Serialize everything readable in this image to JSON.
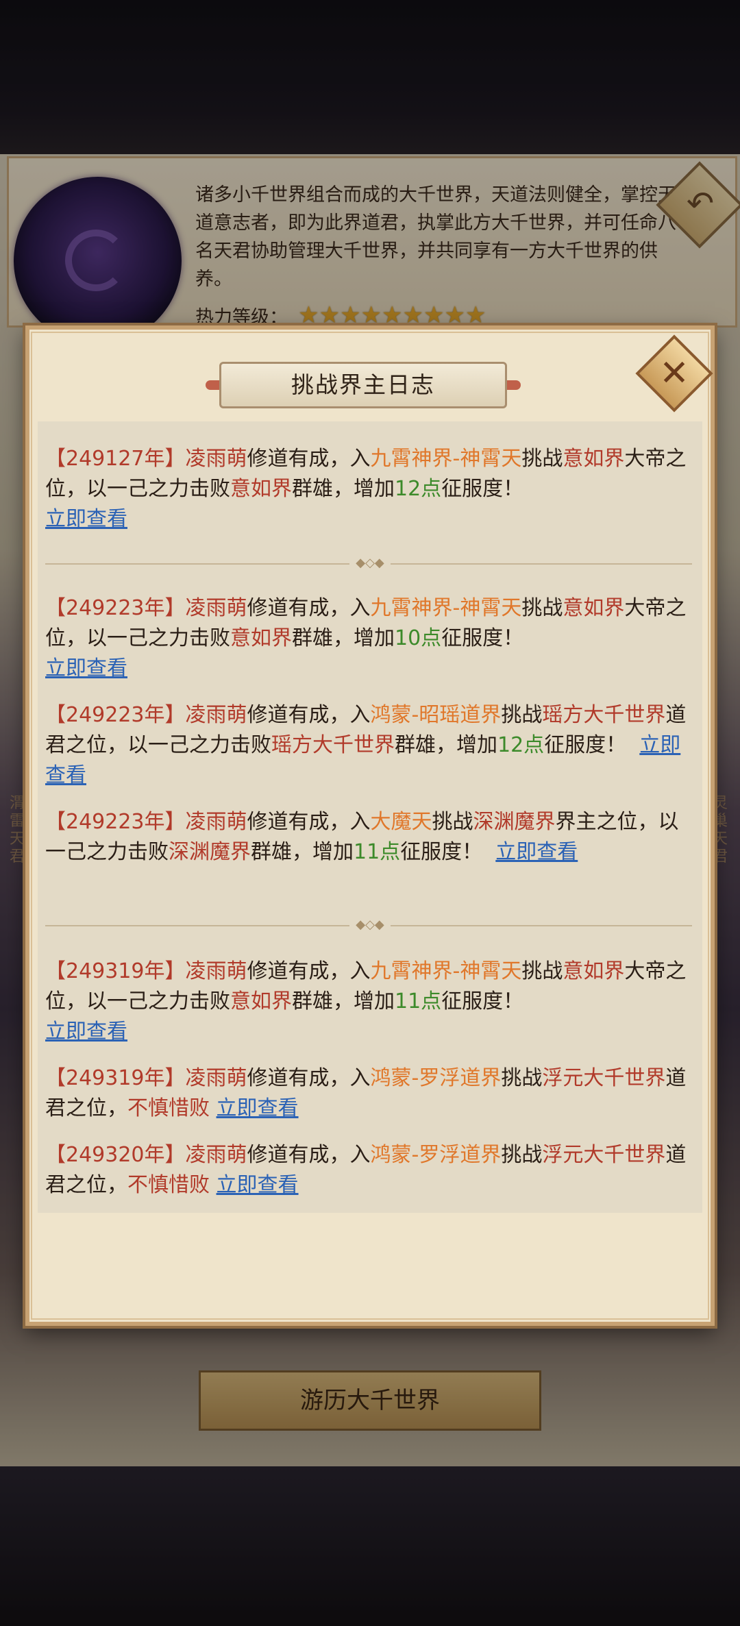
{
  "background": {
    "world_description": "诸多小千世界组合而成的大千世界，天道法则健全，掌控天道意志者，即为此界道君，执掌此方大千世界，并可任命八名天君协助管理大千世界，并共同享有一方大千世界的供养。",
    "heat_label": "热力等级：",
    "heat_stars": 9,
    "travel_button": "游历大千世界",
    "left_tag": "渭雷天君",
    "right_tag": "灵巢天君"
  },
  "modal": {
    "title": "挑战界主日志",
    "entries": [
      {
        "year": "【249127年】",
        "name": "凌雨萌",
        "t1": "修道有成，入",
        "place": "九霄神界-神霄天",
        "t2": "挑战",
        "target": "意如界",
        "t3": "大帝之位，以一己之力击败",
        "target2": "意如界",
        "t4": "群雄，增加",
        "pts": "12点",
        "t5": "征服度！",
        "link": "立即查看"
      },
      {
        "year": "【249223年】",
        "name": "凌雨萌",
        "t1": "修道有成，入",
        "place": "九霄神界-神霄天",
        "t2": "挑战",
        "target": "意如界",
        "t3": "大帝之位，以一己之力击败",
        "target2": "意如界",
        "t4": "群雄，增加",
        "pts": "10点",
        "t5": "征服度！",
        "link": "立即查看"
      },
      {
        "year": "【249223年】",
        "name": "凌雨萌",
        "t1": "修道有成，入",
        "place": "鸿蒙-昭瑶道界",
        "t2": "挑战",
        "target": "瑶方大千世界",
        "t3": "道君之位，以一己之力击败",
        "target2": "瑶方大千世界",
        "t4": "群雄，增加",
        "pts": "12点",
        "t5": "征服度！",
        "link": "立即查看"
      },
      {
        "year": "【249223年】",
        "name": "凌雨萌",
        "t1": "修道有成，入",
        "place": "大魔天",
        "t2": "挑战",
        "target": "深渊魔界",
        "t3": "界主之位，以一己之力击败",
        "target2": "深渊魔界",
        "t4": "群雄，增加",
        "pts": "11点",
        "t5": "征服度！",
        "link": "立即查看"
      },
      {
        "year": "【249319年】",
        "name": "凌雨萌",
        "t1": "修道有成，入",
        "place": "九霄神界-神霄天",
        "t2": "挑战",
        "target": "意如界",
        "t3": "大帝之位，以一己之力击败",
        "target2": "意如界",
        "t4": "群雄，增加",
        "pts": "11点",
        "t5": "征服度！",
        "link": "立即查看"
      },
      {
        "year": "【249319年】",
        "name": "凌雨萌",
        "t1": "修道有成，入",
        "place": "鸿蒙-罗浮道界",
        "t2": "挑战",
        "target": "浮元大千世界",
        "t3": "道君之位，",
        "fail": "不慎惜败",
        "link": "立即查看"
      },
      {
        "year": "【249320年】",
        "name": "凌雨萌",
        "t1": "修道有成，入",
        "place": "鸿蒙-罗浮道界",
        "t2": "挑战",
        "target": "浮元大千世界",
        "t3": "道君之位，",
        "fail": "不慎惜败",
        "link": "立即查看"
      }
    ]
  },
  "colors": {
    "red_text": "#b13a2a",
    "orange_place": "#e0772a",
    "green_points": "#3c8a2a",
    "link_blue": "#2b62b5"
  }
}
